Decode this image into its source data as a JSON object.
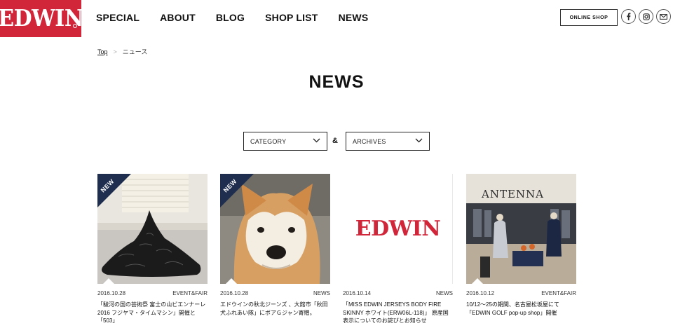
{
  "brand": {
    "logo_text": "EDWIN",
    "color": "#d1263a"
  },
  "nav": [
    "SPECIAL",
    "ABOUT",
    "BLOG",
    "SHOP LIST",
    "NEWS"
  ],
  "header": {
    "online_shop": "ONLINE SHOP",
    "social_icons": [
      "facebook-icon",
      "instagram-icon",
      "mail-icon"
    ]
  },
  "breadcrumb": {
    "home": "Top",
    "separator": ">",
    "current": "ニュース"
  },
  "page_title": "NEWS",
  "filters": {
    "category": "CATEGORY",
    "ampersand": "&",
    "archives": "ARCHIVES"
  },
  "badge": "NEW",
  "articles": [
    {
      "date": "2016.10.28",
      "category": "EVENT&FAIR",
      "title": "「駿河の国の芸術祭 富士の山ビエンナーレ2016 フジヤマ・タイムマシン」開催と「503」",
      "is_new": true
    },
    {
      "date": "2016.10.28",
      "category": "NEWS",
      "title": "エドウインの秋北ジーンズ 、大館市「秋田犬ふれあい隊」にボアＧジャン寄贈。",
      "is_new": true
    },
    {
      "date": "2016.10.14",
      "category": "NEWS",
      "title": "「MISS EDWIN JERSEYS BODY FIRE SKINNY ホワイト(ERW06L-118)」 原産国表示についてのお詫びとお知らせ",
      "is_new": false,
      "image_logo": "EDWIN"
    },
    {
      "date": "2016.10.12",
      "category": "EVENT&FAIR",
      "title": "10/12～25の期間、名古屋松坂屋にて「EDWIN GOLF pop-up shop」開催",
      "is_new": false,
      "image_sign": "ANTENNA"
    }
  ]
}
